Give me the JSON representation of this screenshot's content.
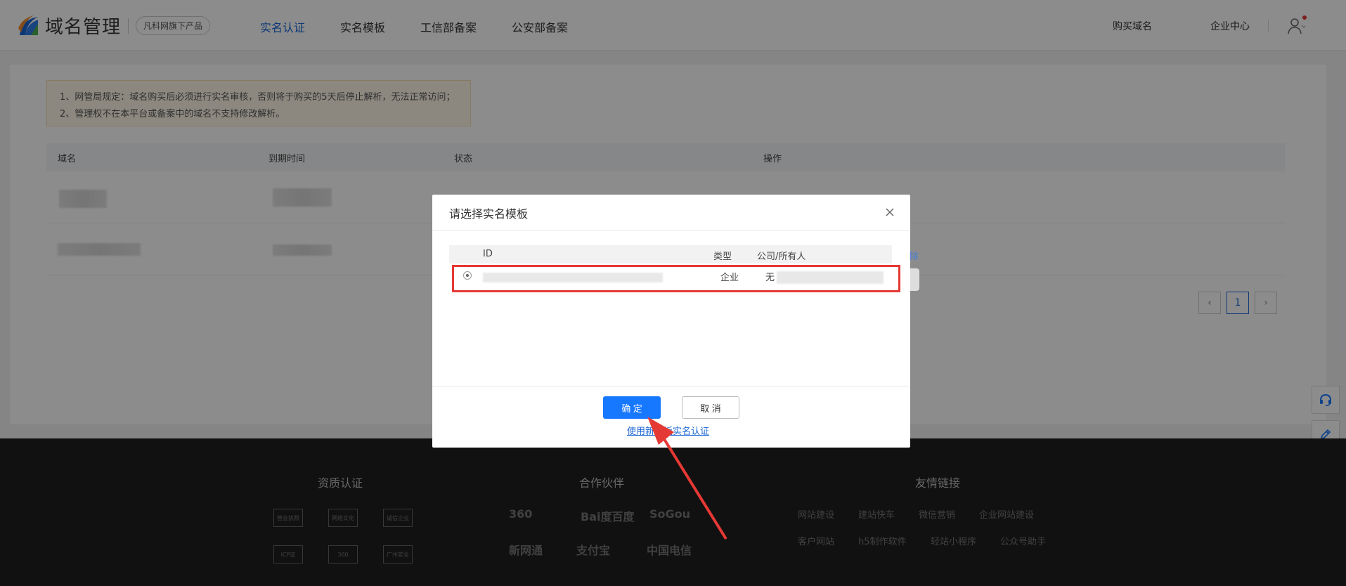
{
  "header": {
    "logo_title": "域名管理",
    "logo_tag": "凡科网旗下产品",
    "nav": [
      {
        "label": "实名认证",
        "active": true
      },
      {
        "label": "实名模板",
        "active": false
      },
      {
        "label": "工信部备案",
        "active": false
      },
      {
        "label": "公安部备案",
        "active": false
      }
    ],
    "buy_domain": "购买域名",
    "enterprise_center": "企业中心"
  },
  "notice": {
    "line1": "1、网管局规定：域名购买后必须进行实名审核，否则将于购买的5天后停止解析，无法正常访问；",
    "line2": "2、管理权不在本平台或备案中的域名不支持修改解析。"
  },
  "table": {
    "columns": [
      "域名",
      "到期时间",
      "状态",
      "操作"
    ],
    "peek_action": "除"
  },
  "pagination": {
    "prev": "‹",
    "current": "1",
    "next": "›"
  },
  "modal": {
    "title": "请选择实名模板",
    "columns": {
      "id": "ID",
      "type": "类型",
      "owner": "公司/所有人"
    },
    "row": {
      "type": "企业",
      "owner_prefix": "无"
    },
    "ok_label": "确 定",
    "cancel_label": "取 消",
    "new_template_link": "使用新模板实名认证"
  },
  "footer": {
    "col1_title": "资质认证",
    "col2_title": "合作伙伴",
    "col3_title": "友情链接",
    "badges": [
      "营业执照",
      "网络文化",
      "诚信企业",
      "ICP证",
      "360",
      "广州安全"
    ],
    "partners": [
      "360",
      "Bai度百度",
      "SoGou",
      "新网通",
      "支付宝",
      "中国电信"
    ],
    "links_row1": [
      "网站建设",
      "建站快车",
      "微信营销",
      "企业网站建设"
    ],
    "links_row2": [
      "客户网站",
      "h5制作软件",
      "轻站小程序",
      "公众号助手"
    ]
  },
  "colors": {
    "primary": "#1677ff",
    "nav_active": "#1a66d6",
    "highlight": "#e53935",
    "footer_bg": "#1f1f1f"
  }
}
